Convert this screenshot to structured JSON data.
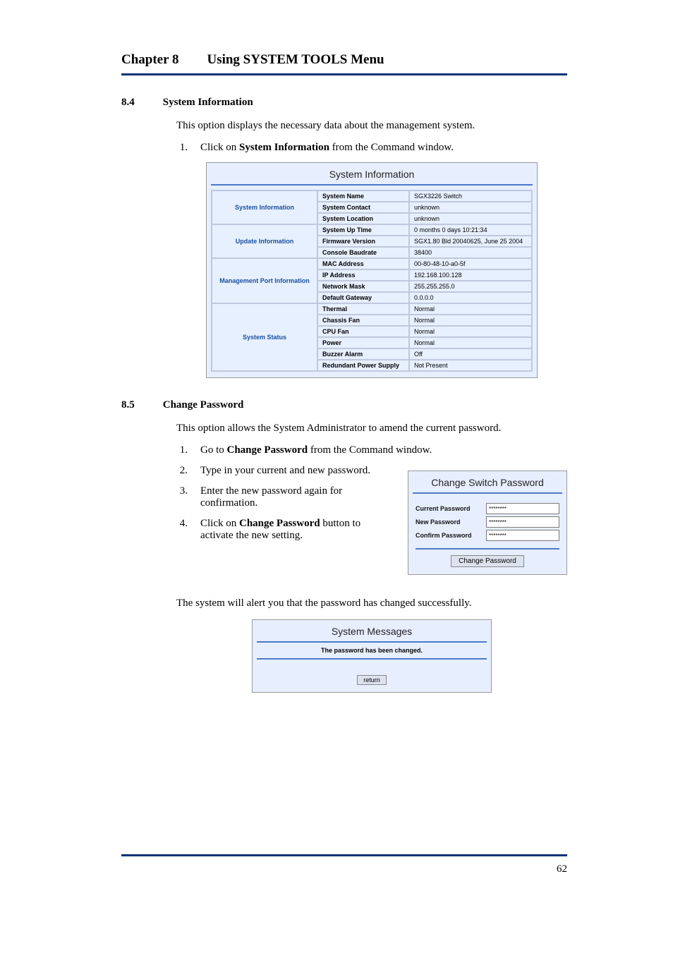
{
  "chapter": {
    "label": "Chapter 8",
    "title": "Using SYSTEM TOOLS Menu"
  },
  "s84": {
    "num": "8.4",
    "title": "System Information",
    "intro": "This option displays the necessary data about the management system.",
    "step1_num": "1.",
    "step1_pre": "Click on ",
    "step1_bold": "System Information",
    "step1_post": " from the Command window."
  },
  "sysinfo": {
    "panel_title": "System Information",
    "groups": [
      {
        "name": "System Information",
        "rows": [
          {
            "label": "System Name",
            "value": "SGX3226 Switch"
          },
          {
            "label": "System Contact",
            "value": "unknown"
          },
          {
            "label": "System Location",
            "value": "unknown"
          }
        ]
      },
      {
        "name": "Update Information",
        "rows": [
          {
            "label": "System Up Time",
            "value": "0 months 0 days 10:21:34"
          },
          {
            "label": "Firmware Version",
            "value": "SGX1.80 Bld 20040625, June 25 2004"
          },
          {
            "label": "Console Baudrate",
            "value": "38400"
          }
        ]
      },
      {
        "name": "Management Port Information",
        "rows": [
          {
            "label": "MAC Address",
            "value": "00-80-48-10-a0-5f"
          },
          {
            "label": "IP Address",
            "value": "192.168.100.128"
          },
          {
            "label": "Network Mask",
            "value": "255.255.255.0"
          },
          {
            "label": "Default Gateway",
            "value": "0.0.0.0"
          }
        ]
      },
      {
        "name": "System Status",
        "rows": [
          {
            "label": "Thermal",
            "value": "Normal"
          },
          {
            "label": "Chassis Fan",
            "value": "Normal"
          },
          {
            "label": "CPU Fan",
            "value": "Normal"
          },
          {
            "label": "Power",
            "value": "Normal"
          },
          {
            "label": "Buzzer Alarm",
            "value": "Off"
          },
          {
            "label": "Redundant Power Supply",
            "value": "Not Present"
          }
        ]
      }
    ]
  },
  "s85": {
    "num": "8.5",
    "title": "Change Password",
    "intro": "This option allows the System Administrator to amend the current password.",
    "steps": {
      "n1": "1.",
      "t1_pre": "Go to ",
      "t1_bold": "Change Password",
      "t1_post": " from the Command window.",
      "n2": "2.",
      "t2": "Type in your current and new password.",
      "n3": "3.",
      "t3": "Enter the new password again for confirmation.",
      "n4": "4.",
      "t4_pre": "Click on ",
      "t4_bold": "Change Password",
      "t4_post": " button to activate the new setting."
    },
    "after": "The system will alert you that the password has changed successfully."
  },
  "pwd": {
    "panel_title": "Change Switch Password",
    "current_label": "Current Password",
    "new_label": "New Password",
    "confirm_label": "Confirm Password",
    "mask": "********",
    "button": "Change Password"
  },
  "msg": {
    "panel_title": "System Messages",
    "text": "The password has been changed.",
    "button": "return"
  },
  "page_number": "62"
}
